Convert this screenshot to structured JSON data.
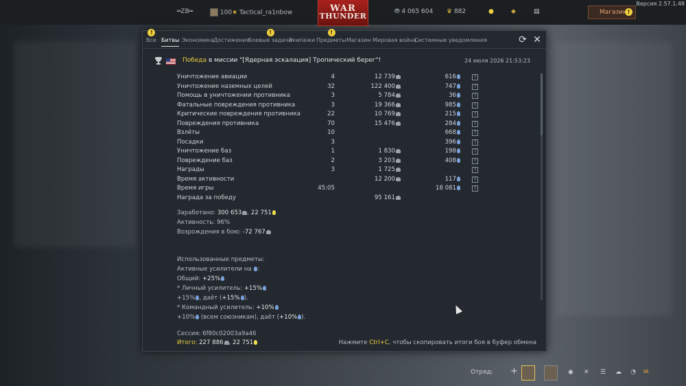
{
  "topbar": {
    "squad_tag": "═ZB═",
    "level": "100",
    "username": "Tactical_ra1nbow",
    "logo_line1": "WAR",
    "logo_line2": "THUNDER",
    "silver_lions": "4 065 604",
    "golden_eagles": "882",
    "shop_label": "Магазин",
    "version": "Версия 2.57.1.48"
  },
  "tabs": [
    {
      "label": "Все",
      "alert": true
    },
    {
      "label": "Битвы",
      "active": true
    },
    {
      "label": "Экономика"
    },
    {
      "label": "Достижения"
    },
    {
      "label": "Боевые задачи",
      "alert": true
    },
    {
      "label": "Экипажи"
    },
    {
      "label": "Предметы",
      "alert": true
    },
    {
      "label": "Магазин"
    },
    {
      "label": "Мировая война"
    },
    {
      "label": "Системные уведомления"
    }
  ],
  "mission": {
    "result": "Победа",
    "text": " в миссии \"[Ядерная эскалация] Тропический берег\"!",
    "date": "24 июля 2026 21:53:23"
  },
  "rows": [
    {
      "name": "Уничтожение авиации",
      "count": "4",
      "sl": "12 739",
      "rp": "616",
      "help": true
    },
    {
      "name": "Уничтожение наземных целей",
      "count": "32",
      "sl": "122 400",
      "rp": "747",
      "help": true
    },
    {
      "name": "Помощь в уничтожении противника",
      "count": "3",
      "sl": "5 784",
      "rp": "36",
      "help": true
    },
    {
      "name": "Фатальные повреждения противника",
      "count": "3",
      "sl": "19 366",
      "rp": "985",
      "help": true
    },
    {
      "name": "Критические повреждения противника",
      "count": "22",
      "sl": "10 769",
      "rp": "215",
      "help": true
    },
    {
      "name": "Повреждения противника",
      "count": "70",
      "sl": "15 476",
      "rp": "284",
      "help": true
    },
    {
      "name": "Взлёты",
      "count": "10",
      "sl": "",
      "rp": "668",
      "help": true
    },
    {
      "name": "Посадки",
      "count": "3",
      "sl": "",
      "rp": "396",
      "help": true
    },
    {
      "name": "Уничтожение баз",
      "count": "1",
      "sl": "1 830",
      "rp": "198",
      "help": true
    },
    {
      "name": "Повреждение баз",
      "count": "2",
      "sl": "3 203",
      "rp": "408",
      "help": true
    },
    {
      "name": "Награды",
      "count": "3",
      "sl": "1 725",
      "rp": "",
      "help": true
    },
    {
      "name": "Время активности",
      "count": "",
      "sl": "12 200",
      "rp": "117",
      "help": true
    },
    {
      "name": "Время игры",
      "count": "45:05",
      "sl": "",
      "rp": "18 081",
      "help": true
    },
    {
      "name": "Награда за победу",
      "count": "",
      "sl": "95 161",
      "rp": "",
      "help": false
    }
  ],
  "summary": {
    "earned_label": "Заработано: ",
    "earned_sl": "300 653",
    "earned_rp": "22 751",
    "activity_label": "Активность: ",
    "activity_val": "96%",
    "respawn_label": "Возрождения в бою: ",
    "respawn_val": "-72 767",
    "used_items": "Использованные предметы:",
    "active_boosters": "Активные усилители на ",
    "common_label": "Общий: ",
    "common_val": "+25%",
    "personal_label": "* Личный усилитель: ",
    "personal_val": "+15%",
    "personal_gives_a": "+15%",
    "personal_gives_b": ", даёт (",
    "personal_gives_c": "+15%",
    "personal_gives_d": ").",
    "squad_label": "* Командный усилитель: ",
    "squad_val": "+10%",
    "squad_gives_a": "+10%",
    "squad_gives_b": " (всем союзникам), даёт (",
    "squad_gives_c": "+10%",
    "squad_gives_d": ").",
    "session_label": "Сессия: ",
    "session_val": "6f80c02003a9a46",
    "total_label": "Итого: ",
    "total_sl": "227 886",
    "total_rp": "22 751",
    "hint_a": "Нажмите ",
    "hint_key": "Ctrl+C",
    "hint_b": ", чтобы скопировать итоги боя в буфер обмена"
  },
  "bottombar": {
    "squad_label": "Отряд:"
  }
}
